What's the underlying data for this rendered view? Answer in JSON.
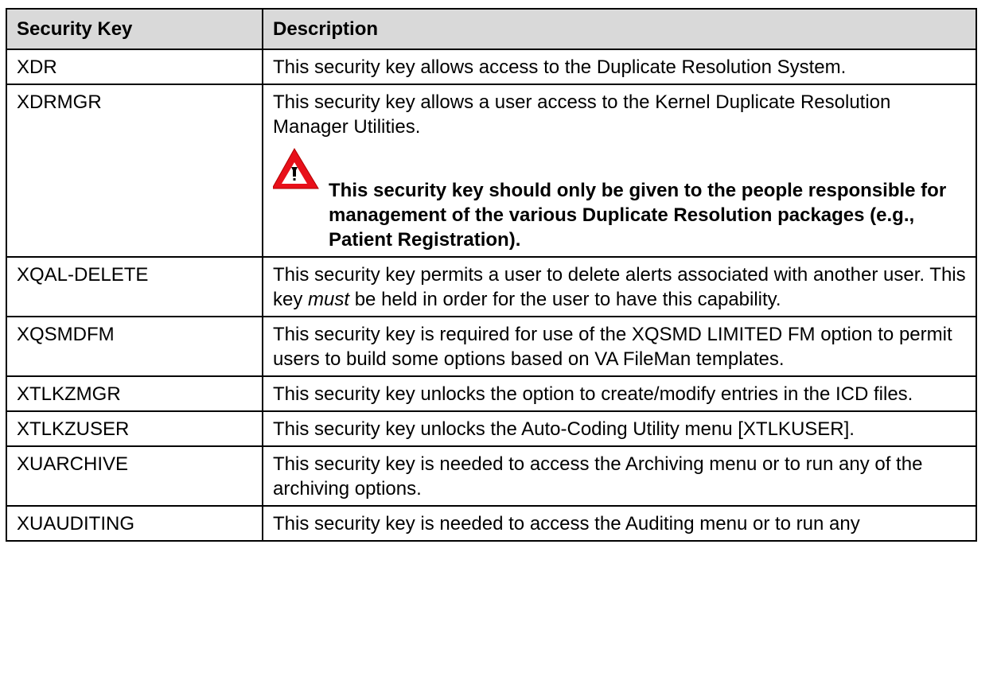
{
  "table": {
    "headers": {
      "key": "Security Key",
      "description": "Description"
    },
    "rows": [
      {
        "key": "XDR",
        "description": "This security key allows access to the Duplicate Resolution System."
      },
      {
        "key": "XDRMGR",
        "description": "This security key allows a user access to the Kernel Duplicate Resolution Manager Utilities.",
        "note": "This security key should only be given to the people responsible for management of the various Duplicate Resolution packages (e.g., Patient Registration).",
        "note_icon": "warning-icon"
      },
      {
        "key": "XQAL-DELETE",
        "description_before": "This security key permits a user to delete alerts associated with another user. This key ",
        "description_emphasis": "must",
        "description_after": " be held in order for the user to have this capability."
      },
      {
        "key": "XQSMDFM",
        "description": "This security key is required for use of the XQSMD LIMITED FM option to permit users to build some options based on VA FileMan templates."
      },
      {
        "key": "XTLKZMGR",
        "description": "This security key unlocks the option to create/modify entries in the ICD files."
      },
      {
        "key": "XTLKZUSER",
        "description": "This security key unlocks the Auto-Coding Utility menu [XTLKUSER]."
      },
      {
        "key": "XUARCHIVE",
        "description": "This security key is needed to access the Archiving menu or to run any of the archiving options."
      },
      {
        "key": "XUAUDITING",
        "description": "This security key is needed to access the Auditing menu or to run any"
      }
    ]
  },
  "colors": {
    "header_background": "#d9d9d9",
    "border": "#000000",
    "warning_red": "#e8101a"
  }
}
